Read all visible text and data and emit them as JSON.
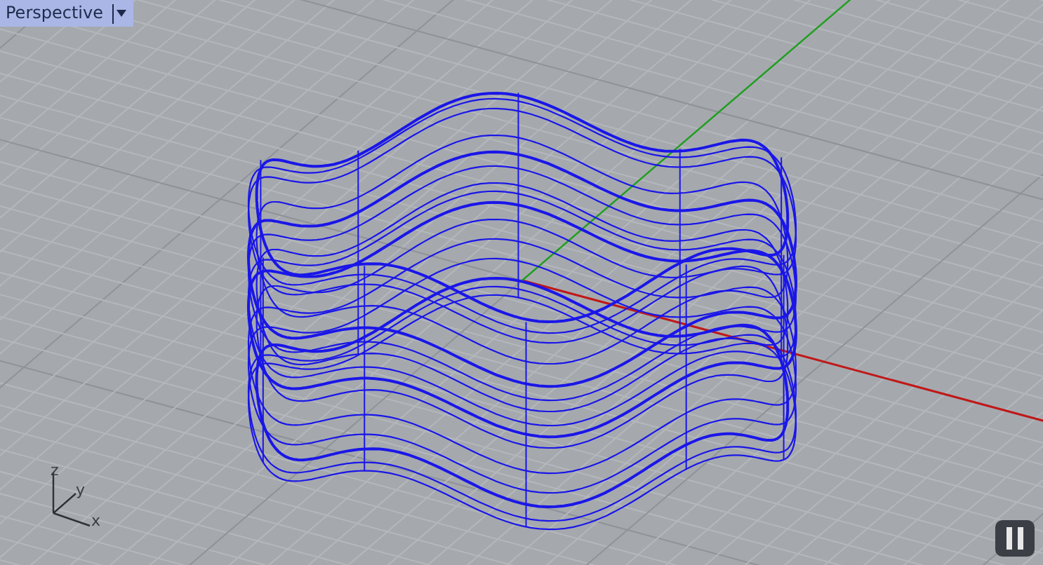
{
  "viewport": {
    "title": "Perspective"
  },
  "axis_labels": [
    "z",
    "y",
    "x"
  ]
}
